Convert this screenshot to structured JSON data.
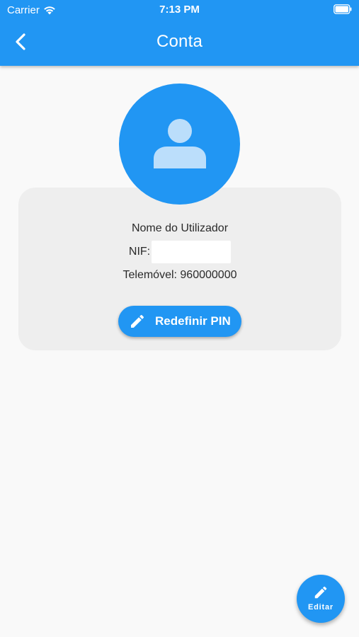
{
  "status_bar": {
    "carrier": "Carrier",
    "time": "7:13 PM"
  },
  "app_bar": {
    "title": "Conta"
  },
  "profile": {
    "name": "Nome do Utilizador",
    "nif_label": "NIF:",
    "nif_value": "",
    "phone": "Telemóvel: 960000000"
  },
  "actions": {
    "reset_pin_label": "Redefinir PIN",
    "edit_label": "Editar"
  },
  "icons": {
    "back": "chevron-left-icon",
    "avatar": "person-icon",
    "pin": "pencil-icon",
    "edit": "pencil-icon"
  },
  "colors": {
    "primary": "#2196f3",
    "background": "#f9f9f9",
    "card": "#eeeeee",
    "avatar_person": "#bbdefb"
  }
}
